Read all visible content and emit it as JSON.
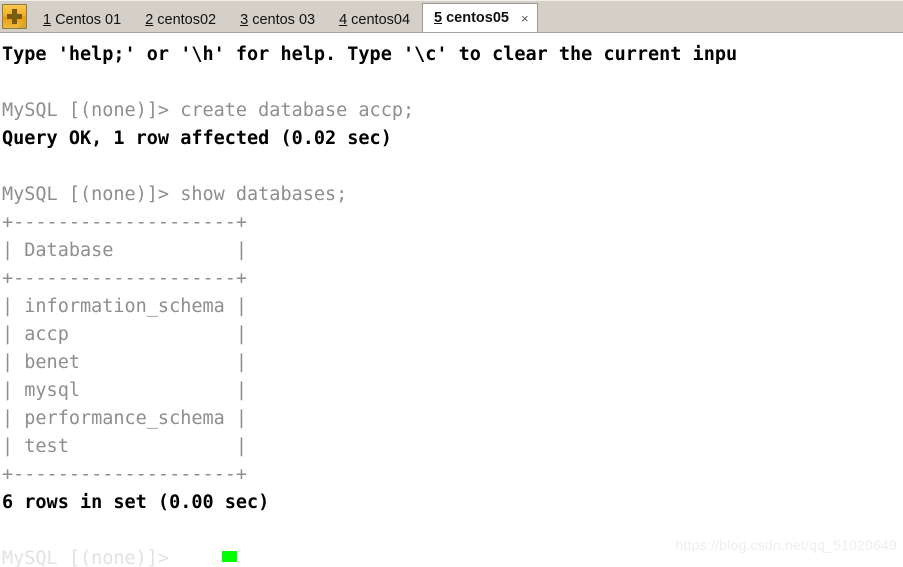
{
  "tabbar": {
    "new_tab_icon": "plus-icon",
    "tabs": [
      {
        "accel": "1",
        "label": "Centos 01",
        "active": false
      },
      {
        "accel": "2",
        "label": "centos02",
        "active": false
      },
      {
        "accel": "3",
        "label": "centos 03",
        "active": false
      },
      {
        "accel": "4",
        "label": "centos04",
        "active": false
      },
      {
        "accel": "5",
        "label": "centos05",
        "active": true
      }
    ],
    "close_label": "×"
  },
  "terminal": {
    "lines": [
      {
        "text": "Type 'help;' or '\\h' for help. Type '\\c' to clear the current inpu",
        "style": "bold"
      },
      {
        "text": "",
        "style": "blank"
      },
      {
        "text": "MySQL [(none)]> create database accp;",
        "style": "dim"
      },
      {
        "text": "Query OK, 1 row affected (0.02 sec)",
        "style": "bold"
      },
      {
        "text": "",
        "style": "blank"
      },
      {
        "text": "MySQL [(none)]> show databases;",
        "style": "dim"
      },
      {
        "text": "+--------------------+",
        "style": "dim"
      },
      {
        "text": "| Database           |",
        "style": "dim"
      },
      {
        "text": "+--------------------+",
        "style": "dim"
      },
      {
        "text": "| information_schema |",
        "style": "dim"
      },
      {
        "text": "| accp               |",
        "style": "dim"
      },
      {
        "text": "| benet              |",
        "style": "dim"
      },
      {
        "text": "| mysql              |",
        "style": "dim"
      },
      {
        "text": "| performance_schema |",
        "style": "dim"
      },
      {
        "text": "| test               |",
        "style": "dim"
      },
      {
        "text": "+--------------------+",
        "style": "dim"
      },
      {
        "text": "6 rows in set (0.00 sec)",
        "style": "bold"
      },
      {
        "text": "",
        "style": "blank"
      }
    ],
    "prompt_line": "MySQL [(none)]>",
    "cursor": "block-cursor",
    "cursor_color": "#00ff00"
  },
  "watermark": {
    "text": "https://blog.csdn.net/qq_51020649"
  }
}
